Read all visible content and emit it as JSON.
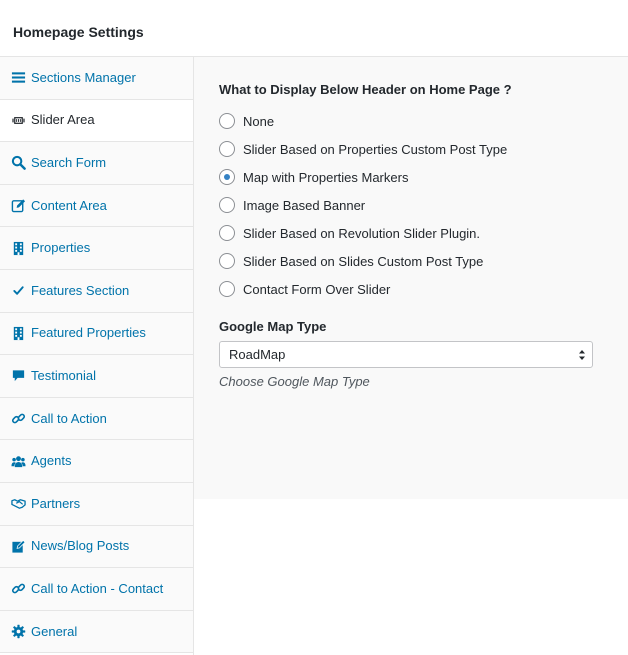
{
  "header": {
    "title": "Homepage Settings"
  },
  "sidebar": {
    "items": [
      {
        "label": "Sections Manager",
        "icon": "list-icon",
        "active": false
      },
      {
        "label": "Slider Area",
        "icon": "slider-icon",
        "active": true
      },
      {
        "label": "Search Form",
        "icon": "search-icon",
        "active": false
      },
      {
        "label": "Content Area",
        "icon": "edit-icon",
        "active": false
      },
      {
        "label": "Properties",
        "icon": "building-icon",
        "active": false
      },
      {
        "label": "Features Section",
        "icon": "check-icon",
        "active": false
      },
      {
        "label": "Featured Properties",
        "icon": "building-icon",
        "active": false
      },
      {
        "label": "Testimonial",
        "icon": "comment-icon",
        "active": false
      },
      {
        "label": "Call to Action",
        "icon": "link-icon",
        "active": false
      },
      {
        "label": "Agents",
        "icon": "users-icon",
        "active": false
      },
      {
        "label": "Partners",
        "icon": "handshake-icon",
        "active": false
      },
      {
        "label": "News/Blog Posts",
        "icon": "edit-icon",
        "active": false
      },
      {
        "label": "Call to Action - Contact",
        "icon": "link-icon",
        "active": false
      },
      {
        "label": "General",
        "icon": "gear-icon",
        "active": false
      }
    ]
  },
  "main": {
    "heading": "What to Display Below Header on Home Page ?",
    "options": [
      {
        "label": "None",
        "checked": false
      },
      {
        "label": "Slider Based on Properties Custom Post Type",
        "checked": false
      },
      {
        "label": "Map with Properties Markers",
        "checked": true
      },
      {
        "label": "Image Based Banner",
        "checked": false
      },
      {
        "label": "Slider Based on Revolution Slider Plugin.",
        "checked": false
      },
      {
        "label": "Slider Based on Slides Custom Post Type",
        "checked": false
      },
      {
        "label": "Contact Form Over Slider",
        "checked": false
      }
    ],
    "map_type": {
      "heading": "Google Map Type",
      "value": "RoadMap",
      "description": "Choose Google Map Type"
    }
  },
  "colors": {
    "link": "#0073aa",
    "radio_checked": "#3582c4",
    "text": "#23282d",
    "border": "#e5e5e5"
  }
}
